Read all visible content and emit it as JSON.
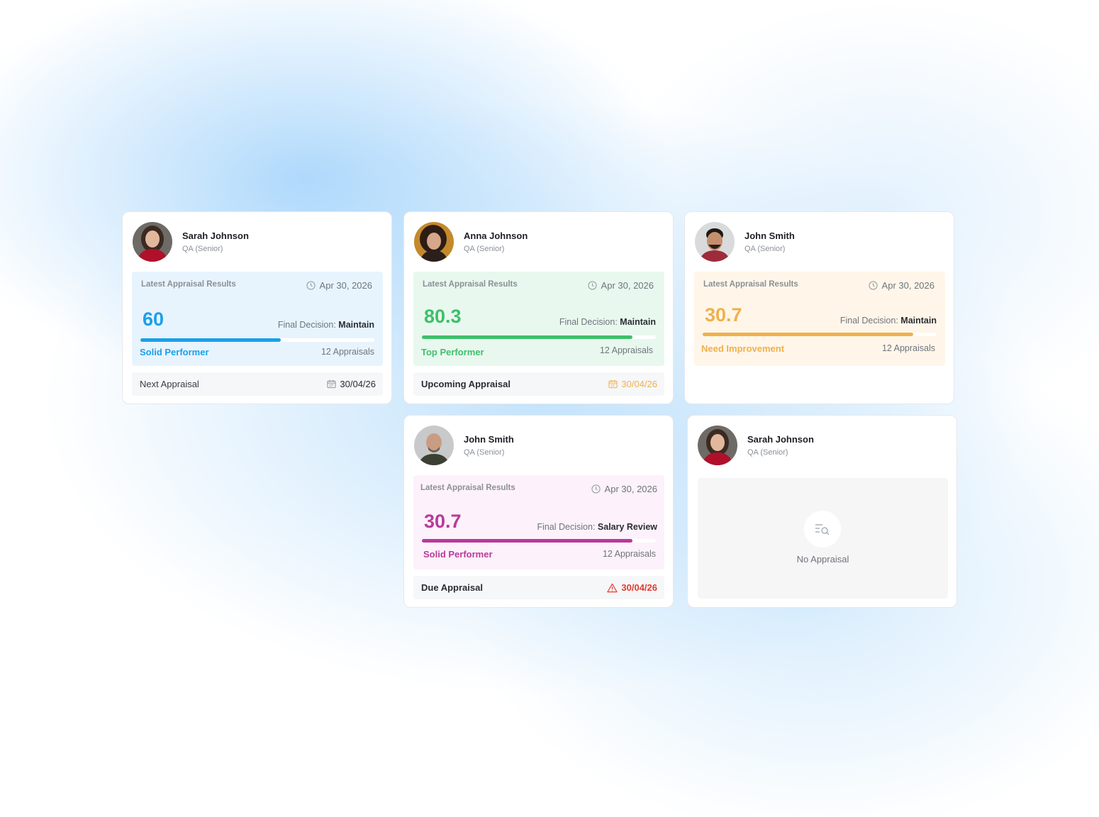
{
  "colors": {
    "blue": "#1aa0ea",
    "green": "#3fbf6b",
    "orange": "#f0b04c",
    "magenta": "#b83a9a",
    "red": "#e23b2f",
    "blue_bg": "#e8f4fd",
    "green_bg": "#e8f8ee",
    "orange_bg": "#fff6e9",
    "pink_bg": "#fdf1fb"
  },
  "cards": [
    {
      "name": "Sarah Johnson",
      "role": "QA (Senior)",
      "avatar": "woman-red-shirt",
      "results_title": "Latest Appraisal Results",
      "date": "Apr 30, 2026",
      "score": "60",
      "decision_label": "Final Decision:",
      "decision": "Maintain",
      "progress": 0.6,
      "performance": "Solid Performer",
      "appraisals": "12 Appraisals",
      "footer_label": "Next Appraisal",
      "footer_date": "30/04/26",
      "footer_icon": "calendar-icon"
    },
    {
      "name": "Anna Johnson",
      "role": "QA (Senior)",
      "avatar": "woman-curly-hair",
      "results_title": "Latest Appraisal Results",
      "date": "Apr 30, 2026",
      "score": "80.3",
      "decision_label": "Final Decision:",
      "decision": "Maintain",
      "progress": 0.9,
      "performance": "Top Performer",
      "appraisals": "12 Appraisals",
      "footer_label": "Upcoming Appraisal",
      "footer_date": "30/04/26",
      "footer_icon": "calendar-icon"
    },
    {
      "name": "John Smith",
      "role": "QA (Senior)",
      "avatar": "man-beard",
      "results_title": "Latest Appraisal Results",
      "date": "Apr 30, 2026",
      "score": "30.7",
      "decision_label": "Final Decision:",
      "decision": "Maintain",
      "progress": 0.9,
      "performance": "Need Improvement",
      "appraisals": "12 Appraisals"
    },
    {
      "name": "John Smith",
      "role": "QA (Senior)",
      "avatar": "man-bald",
      "results_title": "Latest Appraisal Results",
      "date": "Apr 30, 2026",
      "score": "30.7",
      "decision_label": "Final Decision:",
      "decision": "Salary Review",
      "progress": 0.9,
      "performance": "Solid Performer",
      "appraisals": "12 Appraisals",
      "footer_label": "Due Appraisal",
      "footer_date": "30/04/26",
      "footer_icon": "warning-icon"
    },
    {
      "name": "Sarah Johnson",
      "role": "QA (Senior)",
      "avatar": "woman-red-shirt",
      "empty_text": "No Appraisal",
      "empty_icon": "search-list-icon"
    }
  ]
}
